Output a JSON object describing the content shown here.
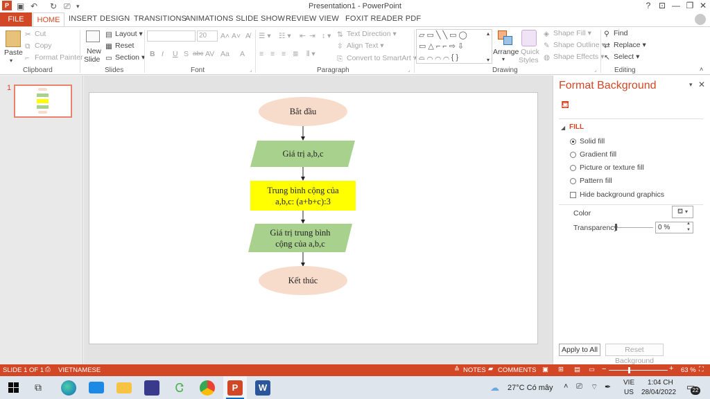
{
  "window": {
    "title": "Presentation1 - PowerPoint",
    "help": "?",
    "buttons": {
      "options": "⊡",
      "minimize": "—",
      "restore": "❐",
      "close": "✕"
    }
  },
  "tabs": [
    "FILE",
    "HOME",
    "INSERT",
    "DESIGN",
    "TRANSITIONS",
    "ANIMATIONS",
    "SLIDE SHOW",
    "REVIEW",
    "VIEW",
    "FOXIT READER PDF"
  ],
  "ribbon": {
    "clipboard": {
      "label": "Clipboard",
      "paste": "Paste",
      "cut": "Cut",
      "copy": "Copy",
      "format_painter": "Format Painter"
    },
    "slides": {
      "label": "Slides",
      "new_slide_line1": "New",
      "new_slide_line2": "Slide",
      "layout": "Layout",
      "reset": "Reset",
      "section": "Section"
    },
    "font": {
      "label": "Font",
      "font_name": "",
      "font_size": "20",
      "b": "B",
      "i": "I",
      "u": "U",
      "s": "S",
      "abc": "abc",
      "av": "AV",
      "aa": "Aa",
      "a": "A"
    },
    "paragraph": {
      "label": "Paragraph",
      "text_direction": "Text Direction",
      "align_text": "Align Text",
      "smartart": "Convert to SmartArt"
    },
    "drawing": {
      "label": "Drawing",
      "arrange": "Arrange",
      "quick_styles_1": "Quick",
      "quick_styles_2": "Styles",
      "shape_fill": "Shape Fill",
      "shape_outline": "Shape Outline",
      "shape_effects": "Shape Effects"
    },
    "editing": {
      "label": "Editing",
      "find": "Find",
      "replace": "Replace",
      "select": "Select"
    }
  },
  "thumbnails": [
    {
      "number": "1"
    }
  ],
  "slide": {
    "flowchart": [
      {
        "kind": "terminal",
        "text": "Bắt đầu",
        "color": "#f8dccb"
      },
      {
        "kind": "io",
        "text": "Giá trị a,b,c",
        "color": "#a9d18e"
      },
      {
        "kind": "process",
        "line1": "Trung bình cộng của",
        "line2": "a,b,c: (a+b+c):3",
        "color": "#ffff00"
      },
      {
        "kind": "io",
        "line1": "Giá trị trung bình",
        "line2": "cộng của a,b,c",
        "color": "#a9d18e"
      },
      {
        "kind": "terminal",
        "text": "Kết thúc",
        "color": "#f8dccb"
      }
    ]
  },
  "format_background": {
    "title": "Format Background",
    "section": "FILL",
    "options": [
      "Solid fill",
      "Gradient fill",
      "Picture or texture fill",
      "Pattern fill"
    ],
    "selected": "Solid fill",
    "hide_bg": "Hide background graphics",
    "color_label": "Color",
    "transparency_label": "Transparency",
    "transparency_value": "0 %",
    "apply_all": "Apply to All",
    "reset": "Reset Background"
  },
  "status": {
    "slide": "SLIDE 1 OF 1",
    "language": "VIETNAMESE",
    "notes": "NOTES",
    "comments": "COMMENTS",
    "zoom": "63 %"
  },
  "taskbar": {
    "weather": "27°C  Có mây",
    "lang1": "VIE",
    "lang2": "US",
    "time": "1:04 CH",
    "date": "28/04/2022",
    "notif": "22"
  },
  "colors": {
    "accent": "#d24726",
    "io_green": "#a9d18e",
    "terminal_peach": "#f8dccb",
    "process_yellow": "#ffff00"
  }
}
